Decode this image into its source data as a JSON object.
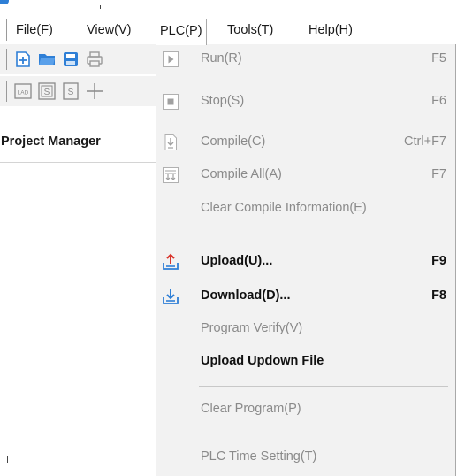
{
  "menubar": {
    "items": [
      {
        "label": "File(F)"
      },
      {
        "label": "View(V)"
      },
      {
        "label": "PLC(P)"
      },
      {
        "label": "Tools(T)"
      },
      {
        "label": "Help(H)"
      }
    ],
    "active_index": 2
  },
  "toolbar1": {
    "icons": [
      "new-project-icon",
      "open-folder-icon",
      "save-icon",
      "print-icon"
    ]
  },
  "toolbar2": {
    "icons": [
      "lad-icon",
      "s-icon",
      "s-outline-icon",
      "crosshair-icon"
    ],
    "lad_text": "LAD",
    "s_text": "S",
    "s2_text": "S"
  },
  "project_manager": {
    "title": "Project Manager"
  },
  "plc_menu": {
    "items": [
      {
        "label": "Run(R)",
        "shortcut": "F5",
        "enabled": false,
        "icon": "run-icon"
      },
      {
        "label": "Stop(S)",
        "shortcut": "F6",
        "enabled": false,
        "icon": "stop-icon"
      },
      {
        "label": "Compile(C)",
        "shortcut": "Ctrl+F7",
        "enabled": false,
        "icon": "compile-icon"
      },
      {
        "label": "Compile All(A)",
        "shortcut": "F7",
        "enabled": false,
        "icon": "compile-all-icon"
      },
      {
        "label": "Clear Compile Information(E)",
        "shortcut": "",
        "enabled": false,
        "icon": ""
      },
      {
        "label": "Upload(U)...",
        "shortcut": "F9",
        "enabled": true,
        "icon": "upload-icon"
      },
      {
        "label": "Download(D)...",
        "shortcut": "F8",
        "enabled": true,
        "icon": "download-icon"
      },
      {
        "label": "Program Verify(V)",
        "shortcut": "",
        "enabled": false,
        "icon": ""
      },
      {
        "label": "Upload Updown File",
        "shortcut": "",
        "enabled": true,
        "icon": ""
      },
      {
        "label": "Clear Program(P)",
        "shortcut": "",
        "enabled": false,
        "icon": ""
      },
      {
        "label": "PLC Time Setting(T)",
        "shortcut": "",
        "enabled": false,
        "icon": ""
      }
    ]
  },
  "colors": {
    "accent_blue": "#2f7fd6",
    "upload_red": "#d9342b",
    "disabled_text": "#8a8a8a",
    "menu_bg": "#f2f2f2"
  }
}
